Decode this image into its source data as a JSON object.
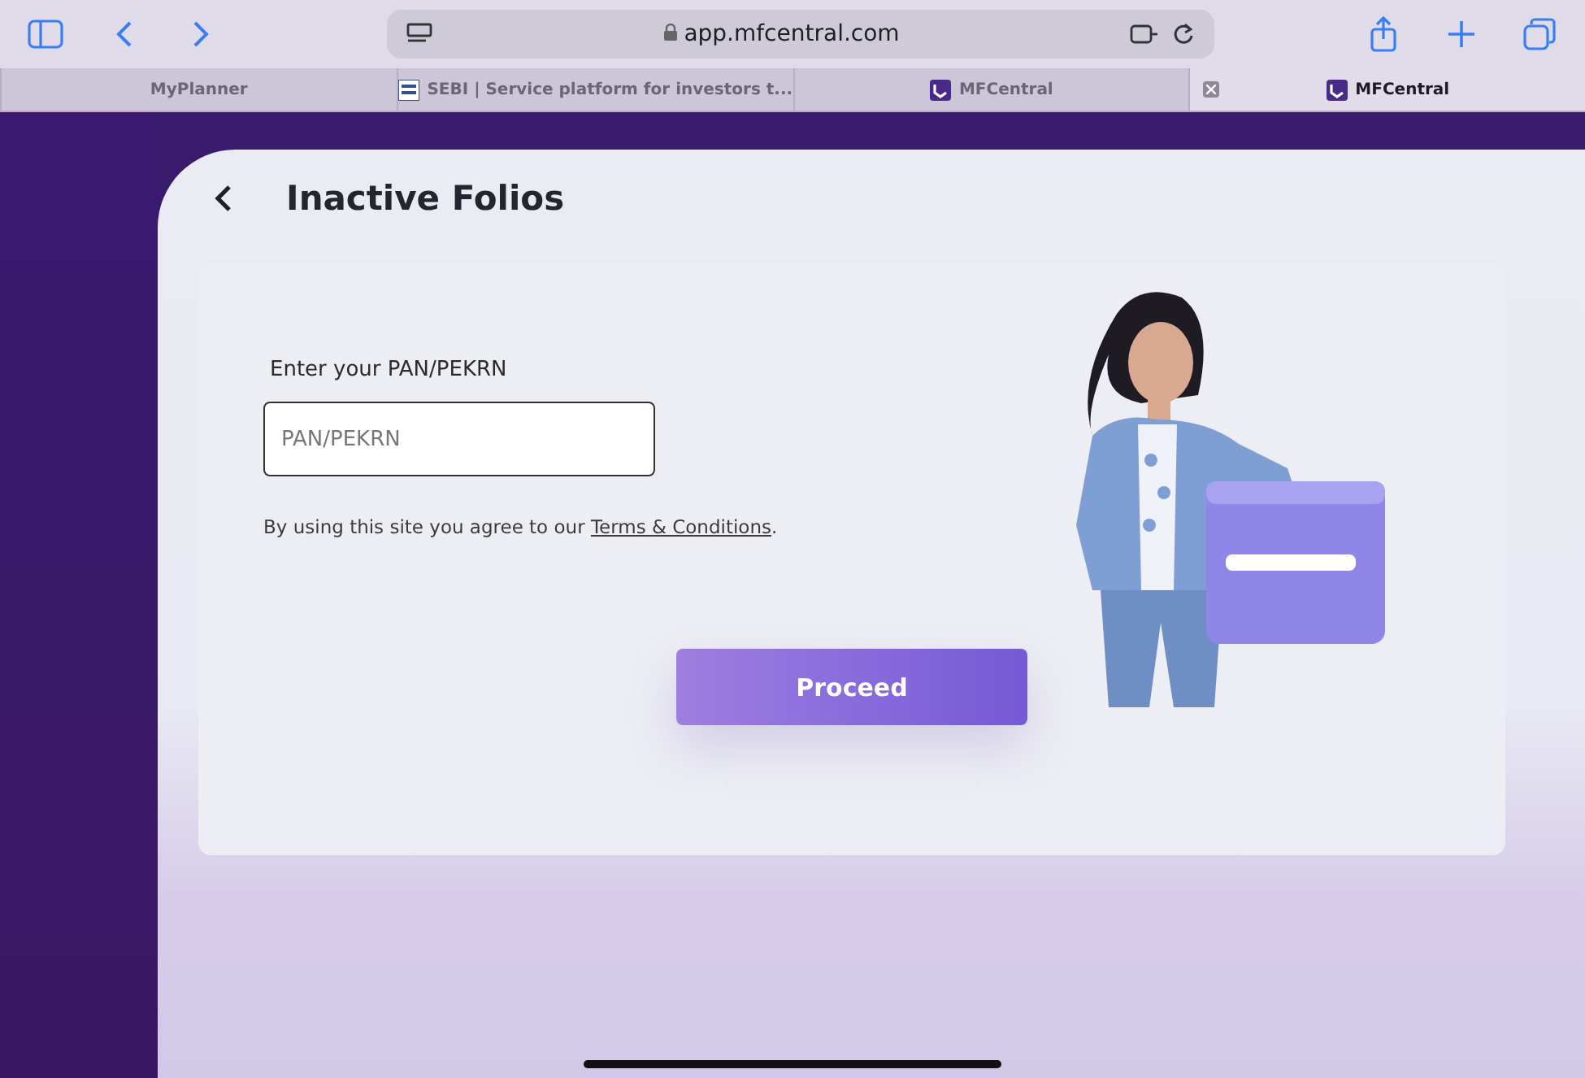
{
  "browser": {
    "url": "app.mfcentral.com"
  },
  "tabs": [
    {
      "title": "MyPlanner",
      "kind": "none",
      "selected": false,
      "closable": false
    },
    {
      "title": "SEBI | Service platform for investors t...",
      "kind": "sebi",
      "selected": false,
      "closable": false
    },
    {
      "title": "MFCentral",
      "kind": "mf",
      "selected": false,
      "closable": false
    },
    {
      "title": "MFCentral",
      "kind": "mf",
      "selected": true,
      "closable": true
    }
  ],
  "page": {
    "title": "Inactive Folios",
    "field": {
      "label": "Enter your PAN/PEKRN",
      "placeholder": "PAN/PEKRN"
    },
    "consent": {
      "text": "By using this site you agree to our ",
      "link": "Terms & Conditions",
      "end": "."
    },
    "button": "Proceed"
  }
}
